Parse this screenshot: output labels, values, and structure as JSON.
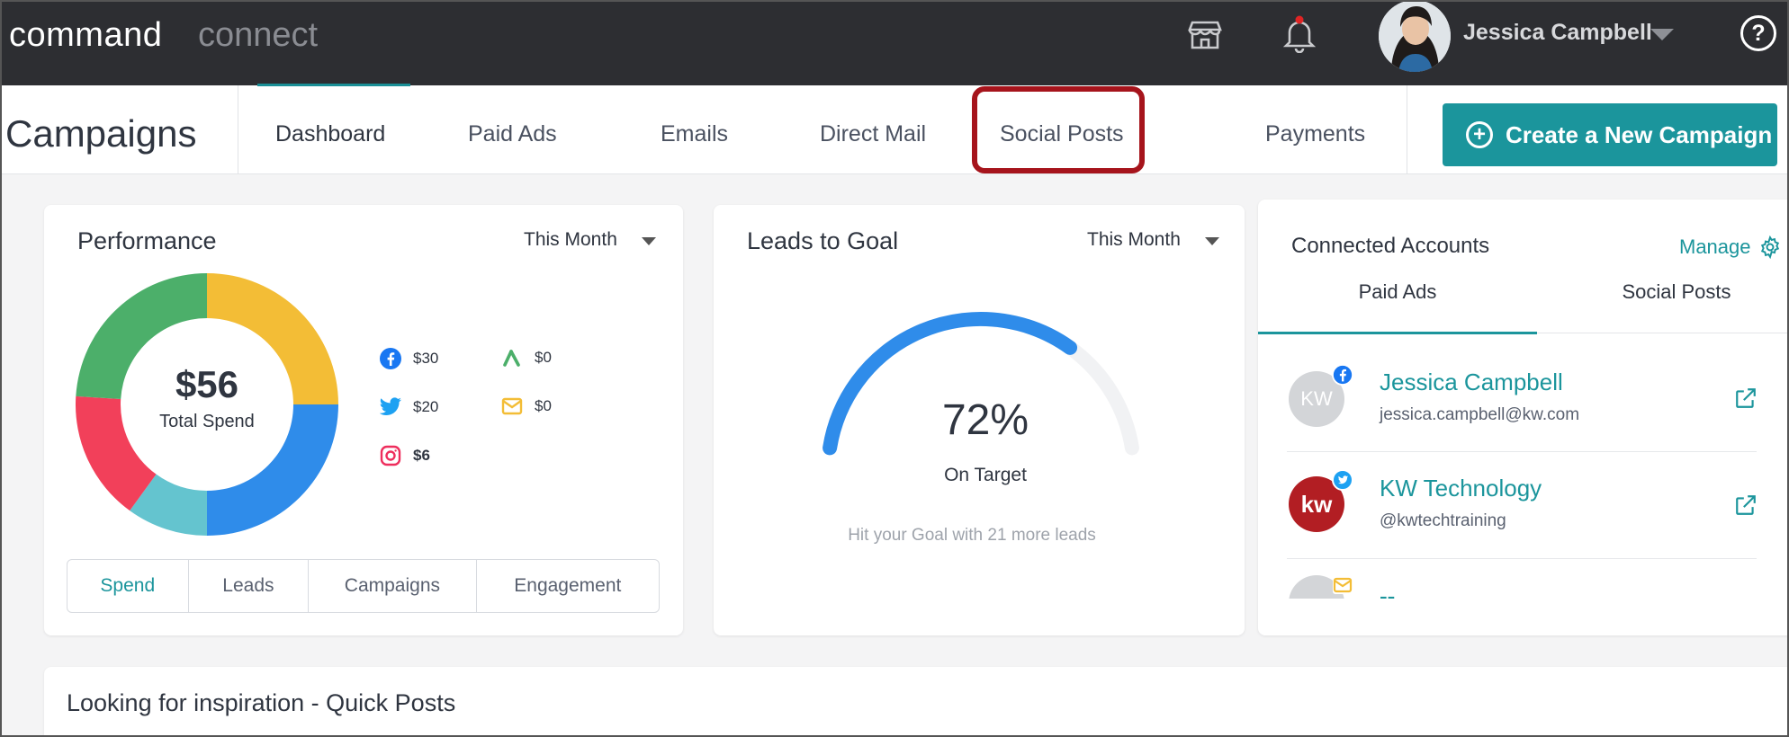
{
  "topbar": {
    "brand_primary": "command",
    "brand_secondary": "connect",
    "user_name": "Jessica Campbell",
    "help_label": "?"
  },
  "nav": {
    "page_title": "Campaigns",
    "tabs": [
      {
        "label": "Dashboard",
        "active": true
      },
      {
        "label": "Paid Ads"
      },
      {
        "label": "Emails"
      },
      {
        "label": "Direct Mail"
      },
      {
        "label": "Social Posts",
        "highlighted": true
      },
      {
        "label": "Payments"
      }
    ],
    "create_button": "Create a New Campaign"
  },
  "performance": {
    "title": "Performance",
    "period": "This Month",
    "total_amount": "$56",
    "total_label": "Total Spend",
    "legend": [
      {
        "channel": "facebook",
        "value": "$30",
        "icon": "facebook-icon"
      },
      {
        "channel": "adwords",
        "value": "$0",
        "icon": "google-ads-icon"
      },
      {
        "channel": "twitter",
        "value": "$20",
        "icon": "twitter-icon"
      },
      {
        "channel": "email",
        "value": "$0",
        "icon": "email-icon"
      },
      {
        "channel": "instagram",
        "value": "$6",
        "icon": "instagram-icon"
      }
    ],
    "segments": [
      "Spend",
      "Leads",
      "Campaigns",
      "Engagement"
    ],
    "active_segment": "Spend"
  },
  "chart_data": {
    "type": "pie",
    "title": "",
    "slices": [
      {
        "color": "#f3bd36",
        "value": 25
      },
      {
        "color": "#2f8cea",
        "value": 25
      },
      {
        "color": "#64c4cf",
        "value": 10
      },
      {
        "color": "#f2405a",
        "value": 16
      },
      {
        "color": "#4caf6a",
        "value": 24
      }
    ]
  },
  "leads": {
    "title": "Leads to Goal",
    "period": "This Month",
    "percent": "72%",
    "percent_value": 0.72,
    "status": "On Target",
    "hint": "Hit your Goal with 21 more leads"
  },
  "connected": {
    "title": "Connected Accounts",
    "manage": "Manage",
    "tabs": [
      "Paid Ads",
      "Social Posts"
    ],
    "accounts": [
      {
        "name": "Jessica Campbell",
        "sub": "jessica.campbell@kw.com",
        "badge": "facebook",
        "avatar": "KW"
      },
      {
        "name": "KW Technology",
        "sub": "@kwtechtraining",
        "badge": "twitter",
        "avatar": "kw"
      },
      {
        "name": "--",
        "sub": "",
        "badge": "email",
        "avatar": ""
      }
    ]
  },
  "inspiration": {
    "title": "Looking for inspiration - Quick Posts"
  },
  "colors": {
    "teal": "#1b959c",
    "topbar": "#2d2e32",
    "highlight": "#a6141c"
  }
}
